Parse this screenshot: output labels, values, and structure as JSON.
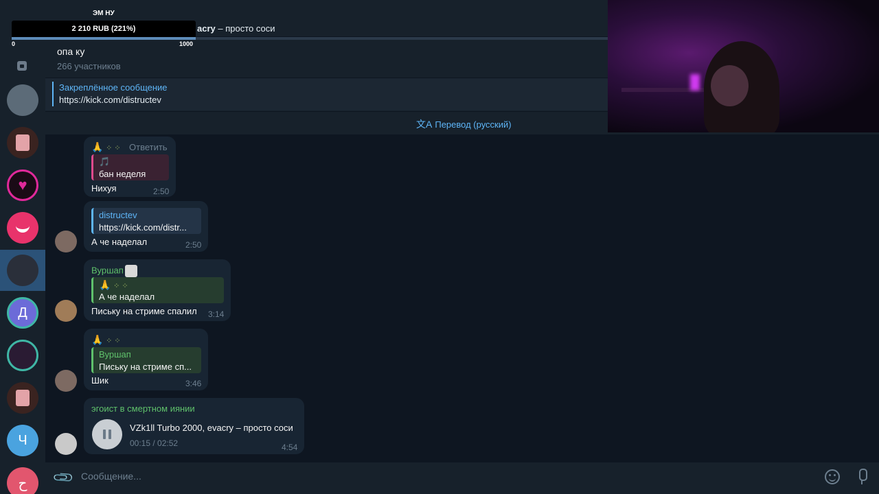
{
  "overlay": {
    "top_label": "ЭМ НУ",
    "amount": "2 210 RUB (221%)",
    "min": "0",
    "max": "1000",
    "progress": 1.0
  },
  "now_playing": {
    "artist": "acry",
    "separator": " – ",
    "title": "просто соси",
    "progress": 0.1
  },
  "chat": {
    "title": "опа ку",
    "subtitle": "266 участников"
  },
  "pinned": {
    "title": "Закреплённое сообщение",
    "text": "https://kick.com/distructev"
  },
  "translate": {
    "label": "Перевод (русский)"
  },
  "messages": [
    {
      "header_emoji": "🙏",
      "reply_action": "Ответить",
      "reply": {
        "name": "🎵",
        "text": "бан неделя",
        "color": "#e04a8c"
      },
      "text": "Нихуя",
      "time": "2:50"
    },
    {
      "reply": {
        "name": "distructev",
        "text": "https://kick.com/distr...",
        "color": "#5eb5f7"
      },
      "text": "А че наделал",
      "time": "2:50"
    },
    {
      "author": "Вуршап",
      "reply": {
        "name": "🙏",
        "text": "А че наделал",
        "color": "#5fc16b"
      },
      "text": "Письку на стриме спалил",
      "time": "3:14"
    },
    {
      "header_emoji": "🙏",
      "reply": {
        "name": "Вуршап",
        "text": "Письку на стриме сп...",
        "color": "#5fc16b"
      },
      "text": "Шик",
      "time": "3:46"
    },
    {
      "author": "эгоист в смертном иянии",
      "audio_title": "VZk1ll Turbo 2000, evacry – просто соси",
      "audio_time": "00:15 / 02:52",
      "time": "4:54"
    }
  ],
  "composer": {
    "placeholder": "Сообщение..."
  },
  "sidebar": {
    "letters": [
      "Д",
      "Ч",
      "ح"
    ]
  },
  "colors": {
    "bg": "#0e1621",
    "panel": "#17212b",
    "bubble": "#182533",
    "accent": "#5eb5f7",
    "green": "#5fc16b"
  }
}
